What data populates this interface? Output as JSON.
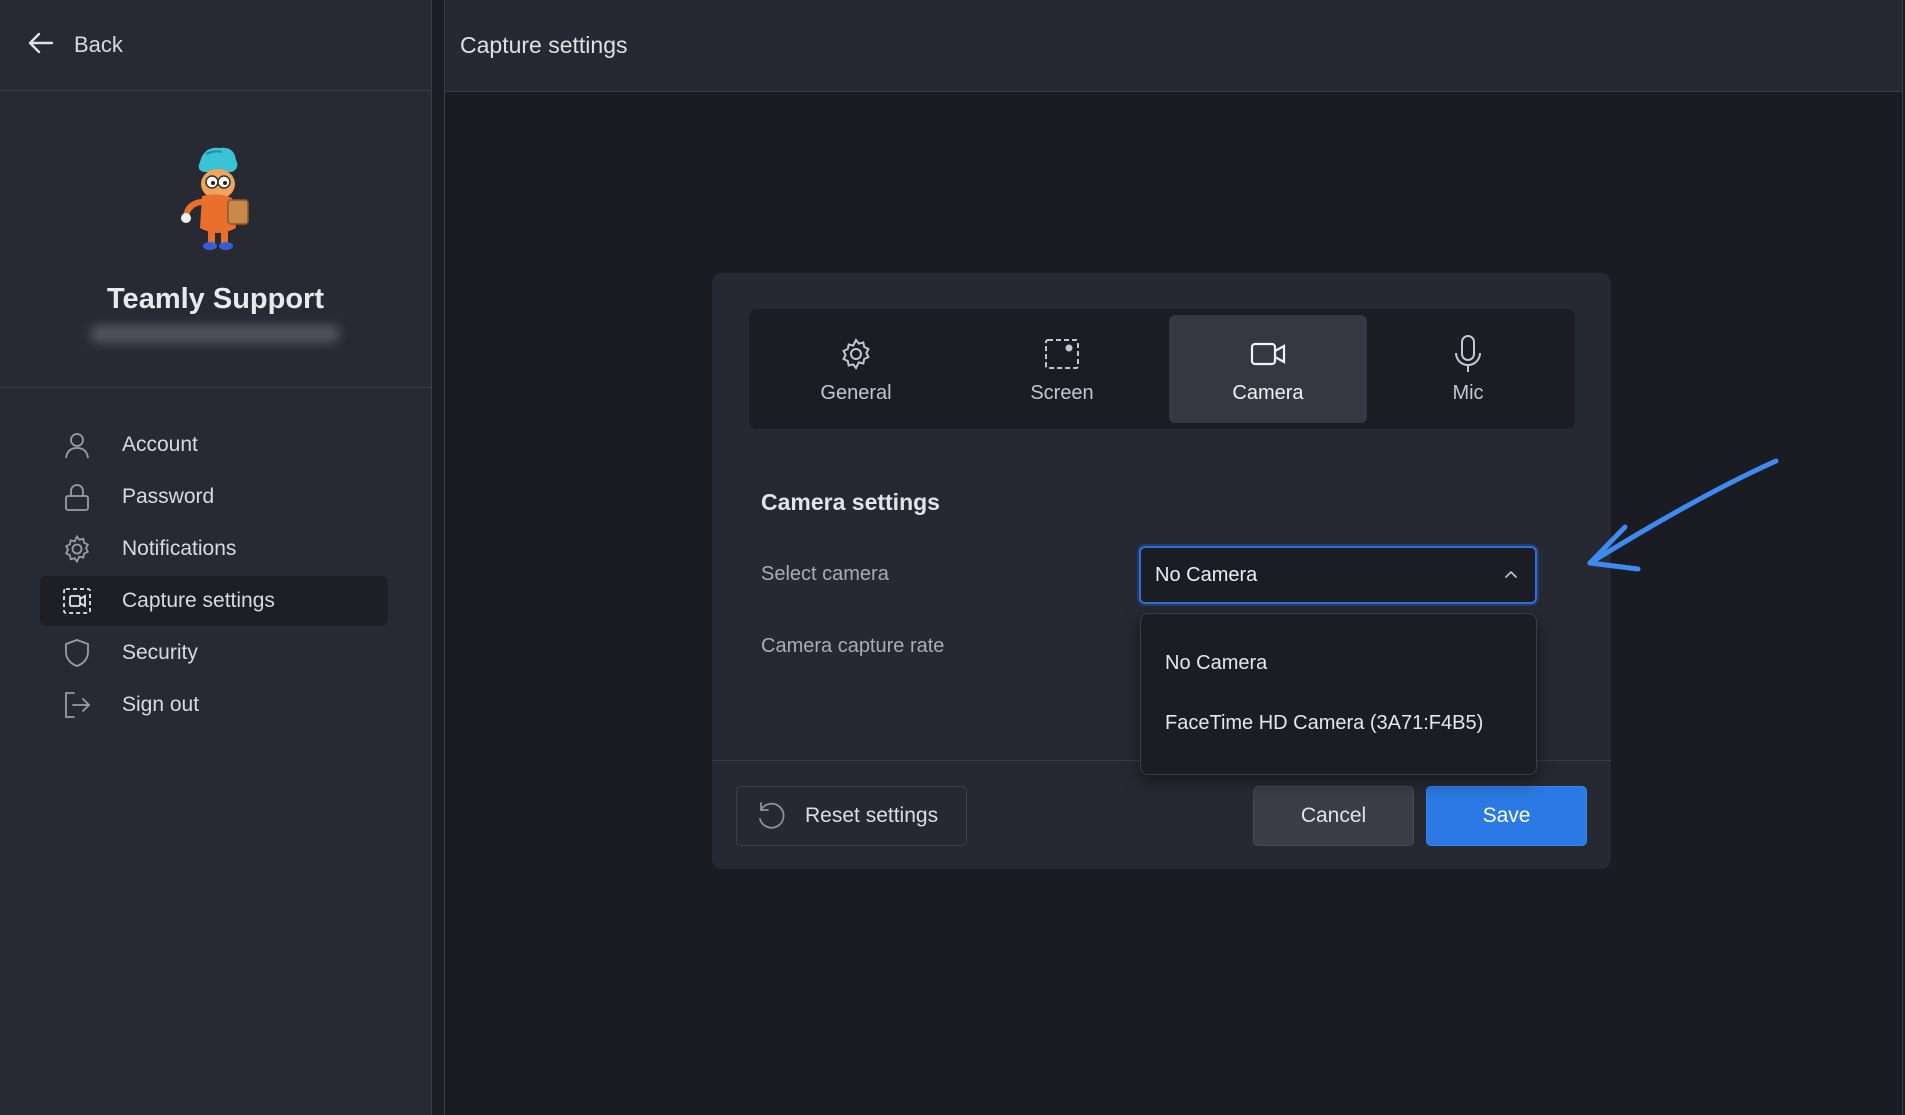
{
  "colors": {
    "accent": "#2b79e4",
    "annotation_arrow": "#3d8bf0",
    "background": "#1b1c23",
    "panel": "#272932"
  },
  "sidebar": {
    "back_label": "Back",
    "profile": {
      "name": "Teamly Support"
    },
    "items": [
      {
        "label": "Account",
        "icon": "user-icon"
      },
      {
        "label": "Password",
        "icon": "lock-icon"
      },
      {
        "label": "Notifications",
        "icon": "gear-icon"
      },
      {
        "label": "Capture settings",
        "icon": "capture-icon",
        "active": true
      },
      {
        "label": "Security",
        "icon": "shield-icon"
      },
      {
        "label": "Sign out",
        "icon": "sign-out-icon"
      }
    ]
  },
  "header": {
    "title": "Capture settings"
  },
  "dialog": {
    "tabs": [
      {
        "label": "General",
        "icon": "gear-icon"
      },
      {
        "label": "Screen",
        "icon": "screen-capture-icon"
      },
      {
        "label": "Camera",
        "icon": "video-camera-icon",
        "active": true
      },
      {
        "label": "Mic",
        "icon": "microphone-icon"
      }
    ],
    "section_title": "Camera settings",
    "select_camera_label": "Select camera",
    "camera_rate_label": "Camera capture rate",
    "select_value": "No Camera",
    "dropdown_options": [
      "No Camera",
      "FaceTime HD Camera (3A71:F4B5)"
    ],
    "reset_label": "Reset settings",
    "cancel_label": "Cancel",
    "save_label": "Save"
  }
}
